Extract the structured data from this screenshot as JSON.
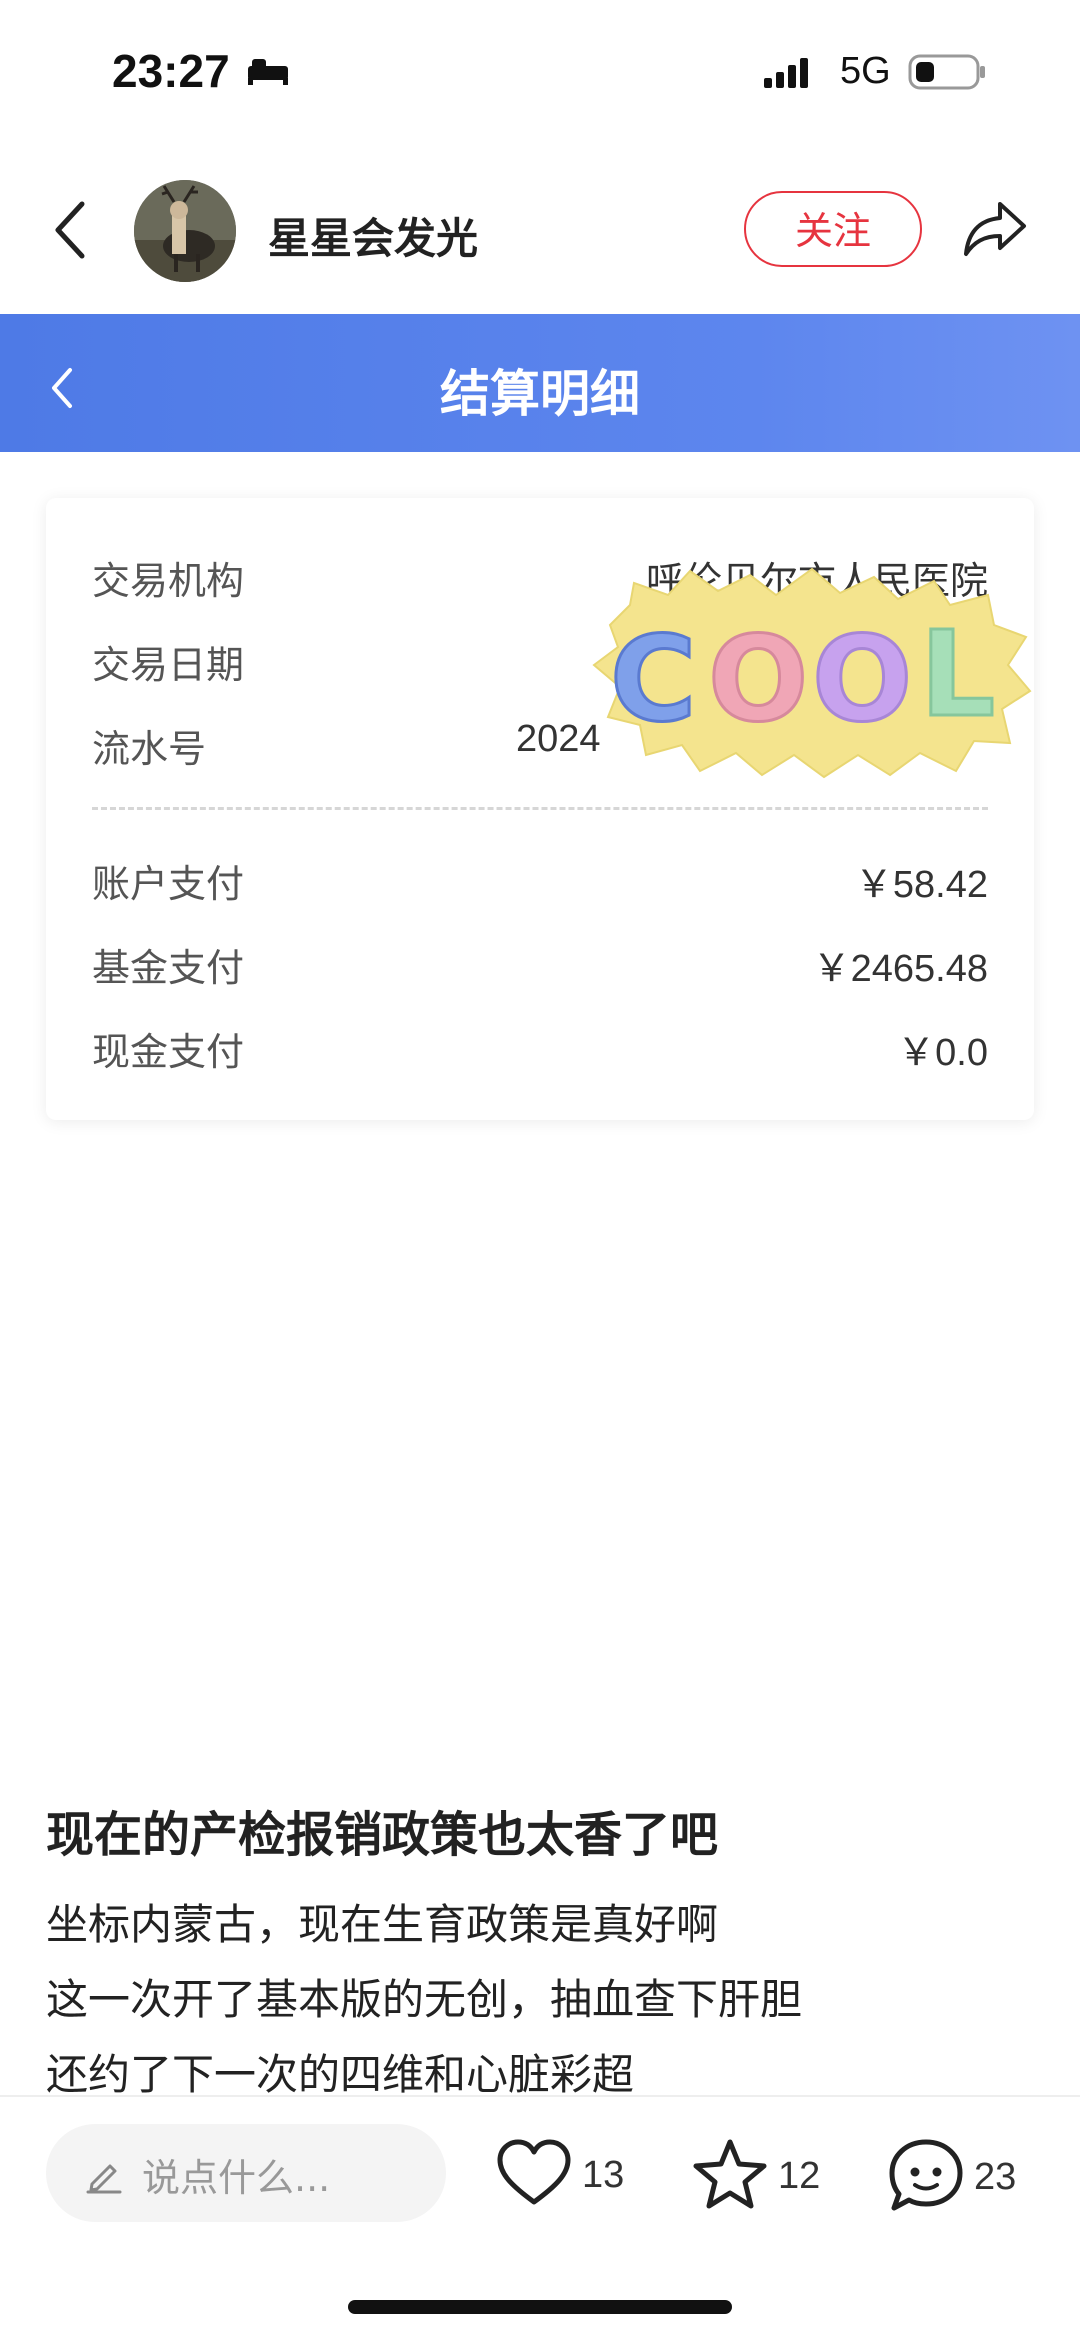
{
  "status_bar": {
    "time": "23:27",
    "network": "5G"
  },
  "header": {
    "username": "星星会发光",
    "follow_label": "关注"
  },
  "page": {
    "title": "结算明细"
  },
  "settlement": {
    "rows_top": [
      {
        "label": "交易机构",
        "value": "呼伦贝尔市人民医院"
      },
      {
        "label": "交易日期",
        "value": ""
      },
      {
        "label": "流水号",
        "value": "2024"
      }
    ],
    "rows_bottom": [
      {
        "label": "账户支付",
        "value": "￥58.42"
      },
      {
        "label": "基金支付",
        "value": "￥2465.48"
      },
      {
        "label": "现金支付",
        "value": "￥0.0"
      }
    ]
  },
  "sticker": {
    "text": "COOL"
  },
  "post": {
    "title": "现在的产检报销政策也太香了吧",
    "lines": [
      "坐标内蒙古，现在生育政策是真好啊",
      "这一次开了基本版的无创，抽血查下肝胆",
      "还约了下一次的四维和心脏彩超"
    ]
  },
  "bottom_bar": {
    "comment_placeholder": "说点什么...",
    "likes": "13",
    "favorites": "12",
    "comments": "23"
  },
  "colors": {
    "accent_red": "#e6343f",
    "header_blue": "#5580ea"
  }
}
